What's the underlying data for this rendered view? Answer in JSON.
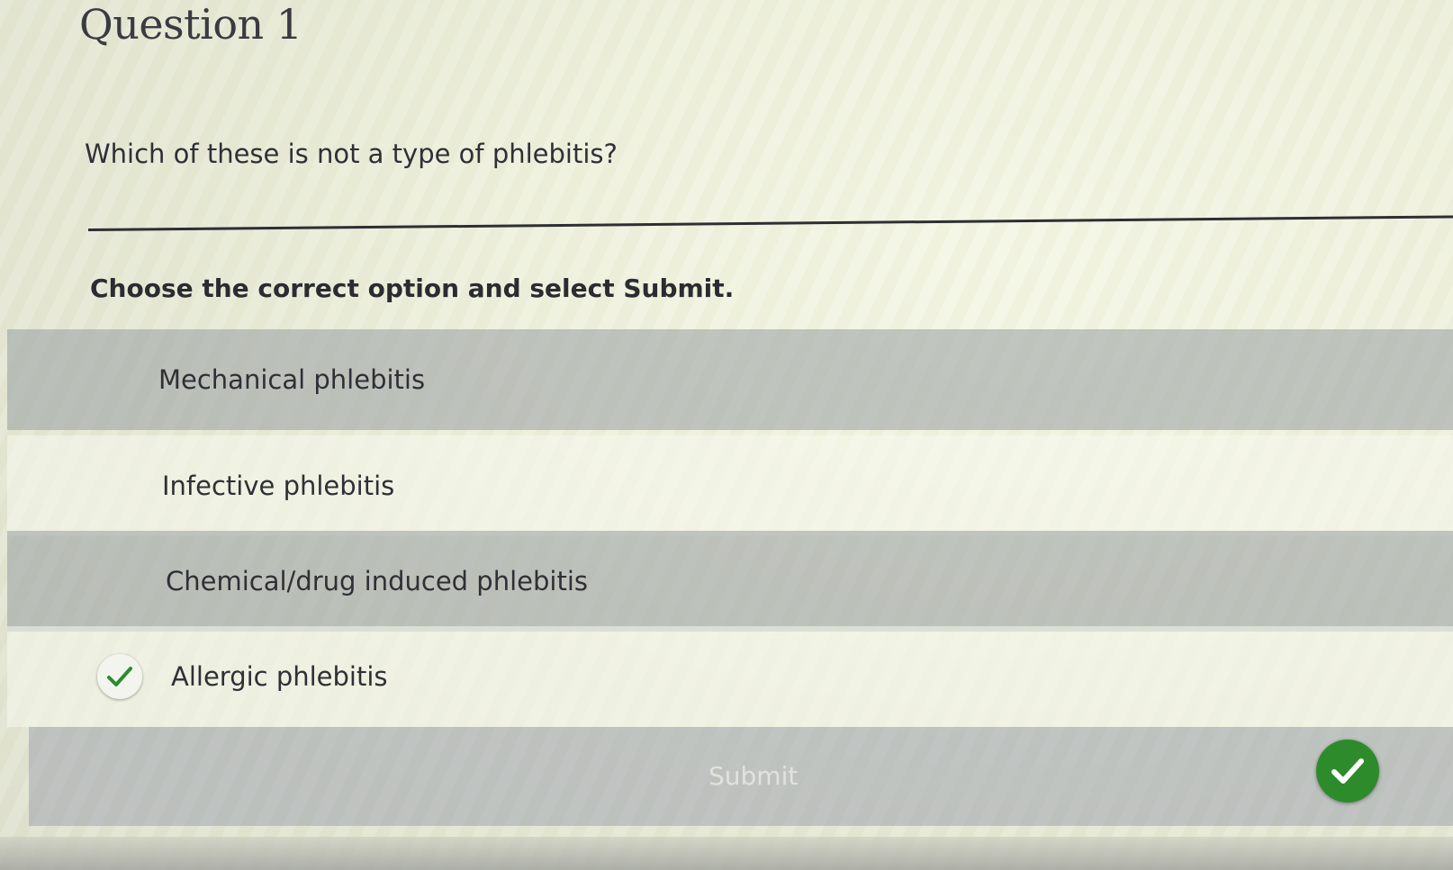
{
  "question": {
    "title": "Question 1",
    "prompt": "Which of these is not a type of phlebitis?",
    "instruction": "Choose the correct option and select Submit."
  },
  "options": [
    {
      "label": "Mechanical phlebitis",
      "selected": false
    },
    {
      "label": "Infective phlebitis",
      "selected": false
    },
    {
      "label": "Chemical/drug induced phlebitis",
      "selected": false
    },
    {
      "label": "Allergic phlebitis",
      "selected": true
    }
  ],
  "submit": {
    "label": "Submit",
    "status_icon": "check-icon",
    "status_color": "#2e8b2c"
  },
  "colors": {
    "selected_check": "#2e8b2c"
  }
}
